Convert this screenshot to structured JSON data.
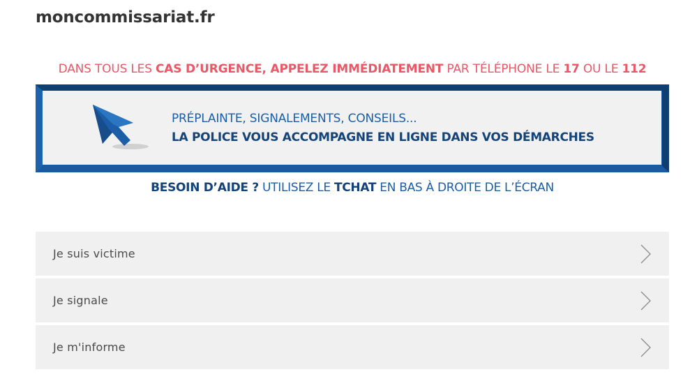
{
  "site": {
    "title": "moncommissariat.fr"
  },
  "urgence": {
    "part1": "DANS TOUS LES ",
    "part2": "CAS D’URGENCE, APPELEZ IMMÉDIATEMENT",
    "part3": " PAR TÉLÉPHONE LE ",
    "number1": "17",
    "part4": " OU LE ",
    "number2": "112",
    "color": "#ea5766"
  },
  "banner": {
    "line1": "PRÉPLAINTE, SIGNALEMENTS, CONSEILS...",
    "line2": "LA POLICE VOUS ACCOMPAGNE EN LIGNE DANS VOS DÉMARCHES",
    "icon": "cursor-arrow-icon",
    "border_color": "#1a5aa3"
  },
  "aide": {
    "part1": "BESOIN D’AIDE ?",
    "part2": " UTILISEZ LE ",
    "part3": "TCHAT",
    "part4": " EN BAS À DROITE DE L’ÉCRAN"
  },
  "menu": {
    "items": [
      {
        "label": "Je suis victime",
        "icon": "chevron-right-icon"
      },
      {
        "label": "Je signale",
        "icon": "chevron-right-icon"
      },
      {
        "label": "Je m'informe",
        "icon": "chevron-right-icon"
      }
    ]
  }
}
